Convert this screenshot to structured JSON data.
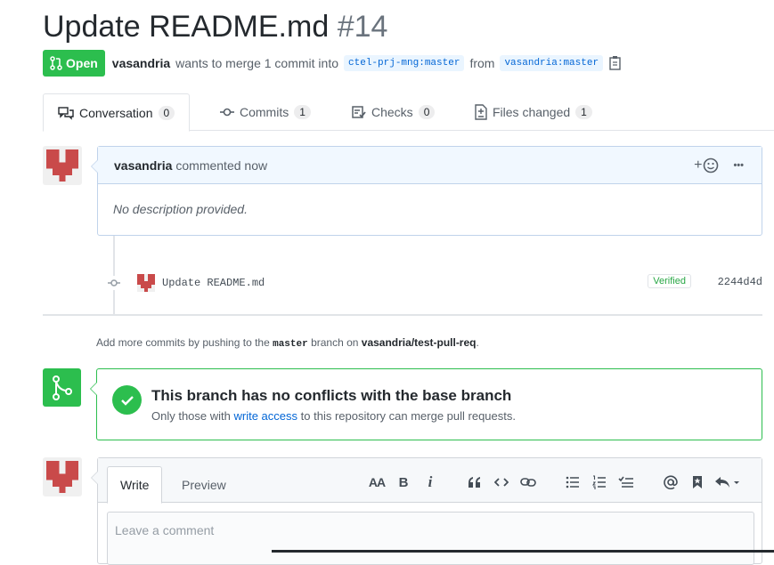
{
  "pr": {
    "title": "Update README.md",
    "number": "#14",
    "state": "Open",
    "author": "vasandria",
    "action_text": "wants to merge 1 commit into",
    "base_branch": "ctel-prj-mng:master",
    "from_text": "from",
    "head_branch": "vasandria:master"
  },
  "tabs": [
    {
      "label": "Conversation",
      "count": "0",
      "icon": "comment-discussion-icon"
    },
    {
      "label": "Commits",
      "count": "1",
      "icon": "git-commit-icon"
    },
    {
      "label": "Checks",
      "count": "0",
      "icon": "checklist-icon"
    },
    {
      "label": "Files changed",
      "count": "1",
      "icon": "file-diff-icon"
    }
  ],
  "comment": {
    "author": "vasandria",
    "time_text": "commented now",
    "reaction_label": "+",
    "more_label": "•••",
    "body": "No description provided."
  },
  "commit": {
    "message": "Update README.md",
    "badge": "Verified",
    "sha": "2244d4d"
  },
  "hint": {
    "prefix": "Add more commits by pushing to the",
    "branch": "master",
    "middle": "branch on",
    "repo": "vasandria/test-pull-req",
    "suffix": "."
  },
  "merge": {
    "title": "This branch has no conflicts with the base branch",
    "sub_prefix": "Only those with",
    "sub_link": "write access",
    "sub_suffix": "to this repository can merge pull requests."
  },
  "new_comment": {
    "write_tab": "Write",
    "preview_tab": "Preview",
    "placeholder": "Leave a comment",
    "toolbar": {
      "header": "AA",
      "bold": "B",
      "italic": "i"
    }
  },
  "colors": {
    "green": "#2cbe4e",
    "link": "#0366d6",
    "avatar_red": "#c94a4a"
  }
}
